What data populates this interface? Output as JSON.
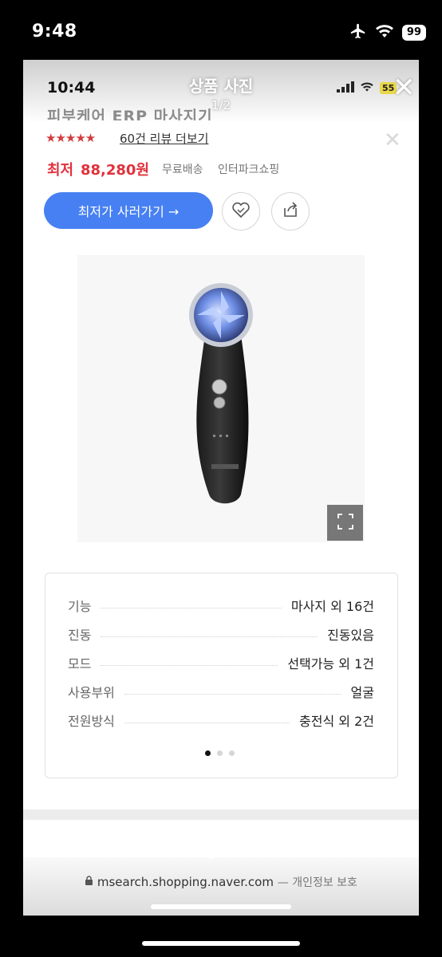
{
  "outer_status": {
    "time": "9:48",
    "battery": "99"
  },
  "inner_status": {
    "time": "10:44",
    "battery": "55"
  },
  "viewer": {
    "title": "상품 사진",
    "counter": "1/2"
  },
  "product": {
    "title_partial": "피부케어 ERP 마사지기",
    "rating_stars": "★★★★★",
    "review_link": "60건 리뷰 더보기",
    "price_label": "최저",
    "price": "88,280원",
    "shipping": "무료배송",
    "shop": "인터파크쇼핑",
    "buy_button": "최저가 사러가기 →"
  },
  "specs": [
    {
      "key": "기능",
      "value": "마사지 외 16건"
    },
    {
      "key": "진동",
      "value": "진동있음"
    },
    {
      "key": "모드",
      "value": "선택가능 외 1건"
    },
    {
      "key": "사용부위",
      "value": "얼굴"
    },
    {
      "key": "전원방식",
      "value": "충전식 외 2건"
    }
  ],
  "url_bar": {
    "url": "msearch.shopping.naver.com",
    "privacy": "— 개인정보 보호"
  },
  "colors": {
    "accent_blue": "#4780f2",
    "price_red": "#e1313c",
    "star_red": "#d23d3d"
  }
}
